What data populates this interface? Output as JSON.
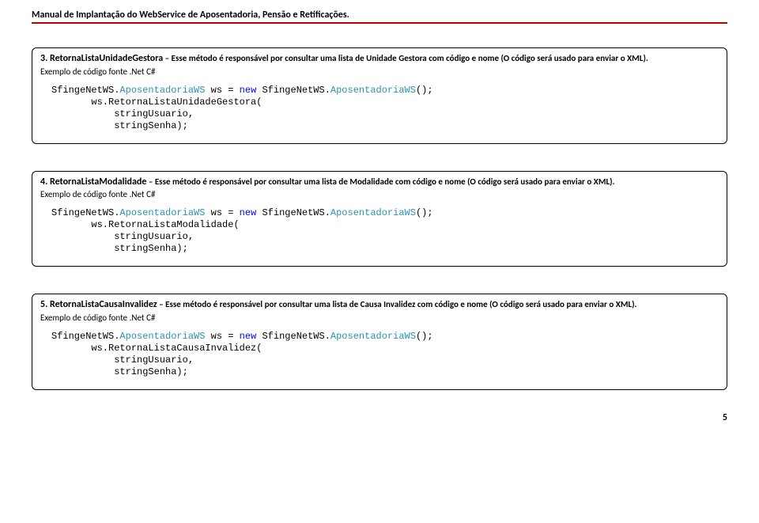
{
  "header_title": "Manual de Implantação do WebService de Aposentadoria, Pensão e Retificações.",
  "sections": [
    {
      "num": "3.",
      "method": "RetornaListaUnidadeGestora",
      "sep": " – ",
      "desc": "Esse método é responsável por consultar uma lista de Unidade Gestora com código e nome (O código será usado para enviar o XML).",
      "caption": "Exemplo de código fonte .Net C#",
      "code": {
        "prefix1": "SfingeNetWS.",
        "class1": "AposentadoriaWS",
        "mid1": " ws = ",
        "kw_new": "new",
        "mid2": " SfingeNetWS.",
        "class2": "AposentadoriaWS",
        "suffix1": "();",
        "line2": "       ws.RetornaListaUnidadeGestora(",
        "line3": "           stringUsuario,",
        "line4": "           stringSenha);"
      }
    },
    {
      "num": "4.",
      "method": "RetornaListaModalidade",
      "sep": " – ",
      "desc": "Esse método é responsável por consultar uma lista de Modalidade com código e nome (O código será usado para enviar o XML).",
      "caption": "Exemplo de código fonte .Net C#",
      "code": {
        "prefix1": "SfingeNetWS.",
        "class1": "AposentadoriaWS",
        "mid1": " ws = ",
        "kw_new": "new",
        "mid2": " SfingeNetWS.",
        "class2": "AposentadoriaWS",
        "suffix1": "();",
        "line2": "       ws.RetornaListaModalidade(",
        "line3": "           stringUsuario,",
        "line4": "           stringSenha);"
      }
    },
    {
      "num": "5.",
      "method": "RetornaListaCausaInvalidez",
      "sep": " – ",
      "desc": "Esse método é responsável por consultar uma lista de Causa Invalidez com código e nome (O código será usado para enviar o XML).",
      "caption": "Exemplo de código fonte .Net C#",
      "code": {
        "prefix1": "SfingeNetWS.",
        "class1": "AposentadoriaWS",
        "mid1": " ws = ",
        "kw_new": "new",
        "mid2": " SfingeNetWS.",
        "class2": "AposentadoriaWS",
        "suffix1": "();",
        "line2": "       ws.RetornaListaCausaInvalidez(",
        "line3": "           stringUsuario,",
        "line4": "           stringSenha);"
      }
    }
  ],
  "page_number": "5"
}
